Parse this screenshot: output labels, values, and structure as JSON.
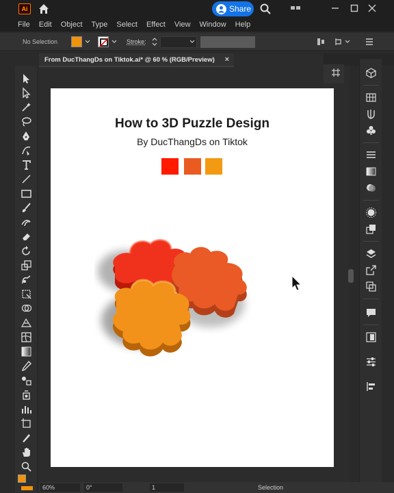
{
  "titlebar": {
    "app_logo": "Ai",
    "share_label": "Share"
  },
  "menu": [
    "File",
    "Edit",
    "Object",
    "Type",
    "Select",
    "Effect",
    "View",
    "Window",
    "Help"
  ],
  "controlbar": {
    "selection_text": "No Selection",
    "fill_color": "#f1930c",
    "stroke_label": "Stroke:"
  },
  "document": {
    "tab_title": "From DucThangDs on Tiktok.ai* @ 60 % (RGB/Preview)",
    "close_glyph": "×"
  },
  "artwork": {
    "title": "How to 3D Puzzle Design",
    "subtitle": "By DucThangDs on Tiktok",
    "swatches": [
      "#ff1a00",
      "#ea5b22",
      "#f29a12"
    ],
    "pieces": [
      {
        "name": "red-piece",
        "color": "#f0321c"
      },
      {
        "name": "orange-red-piece",
        "color": "#ea5a26"
      },
      {
        "name": "orange-piece",
        "color": "#f2921a"
      }
    ]
  },
  "statusbar": {
    "zoom": "60%",
    "rotation": "0°",
    "artboard_number": "1",
    "tool_name": "Selection"
  },
  "colors": {
    "accent": "#1473e6",
    "logo": "#ff9a00"
  }
}
